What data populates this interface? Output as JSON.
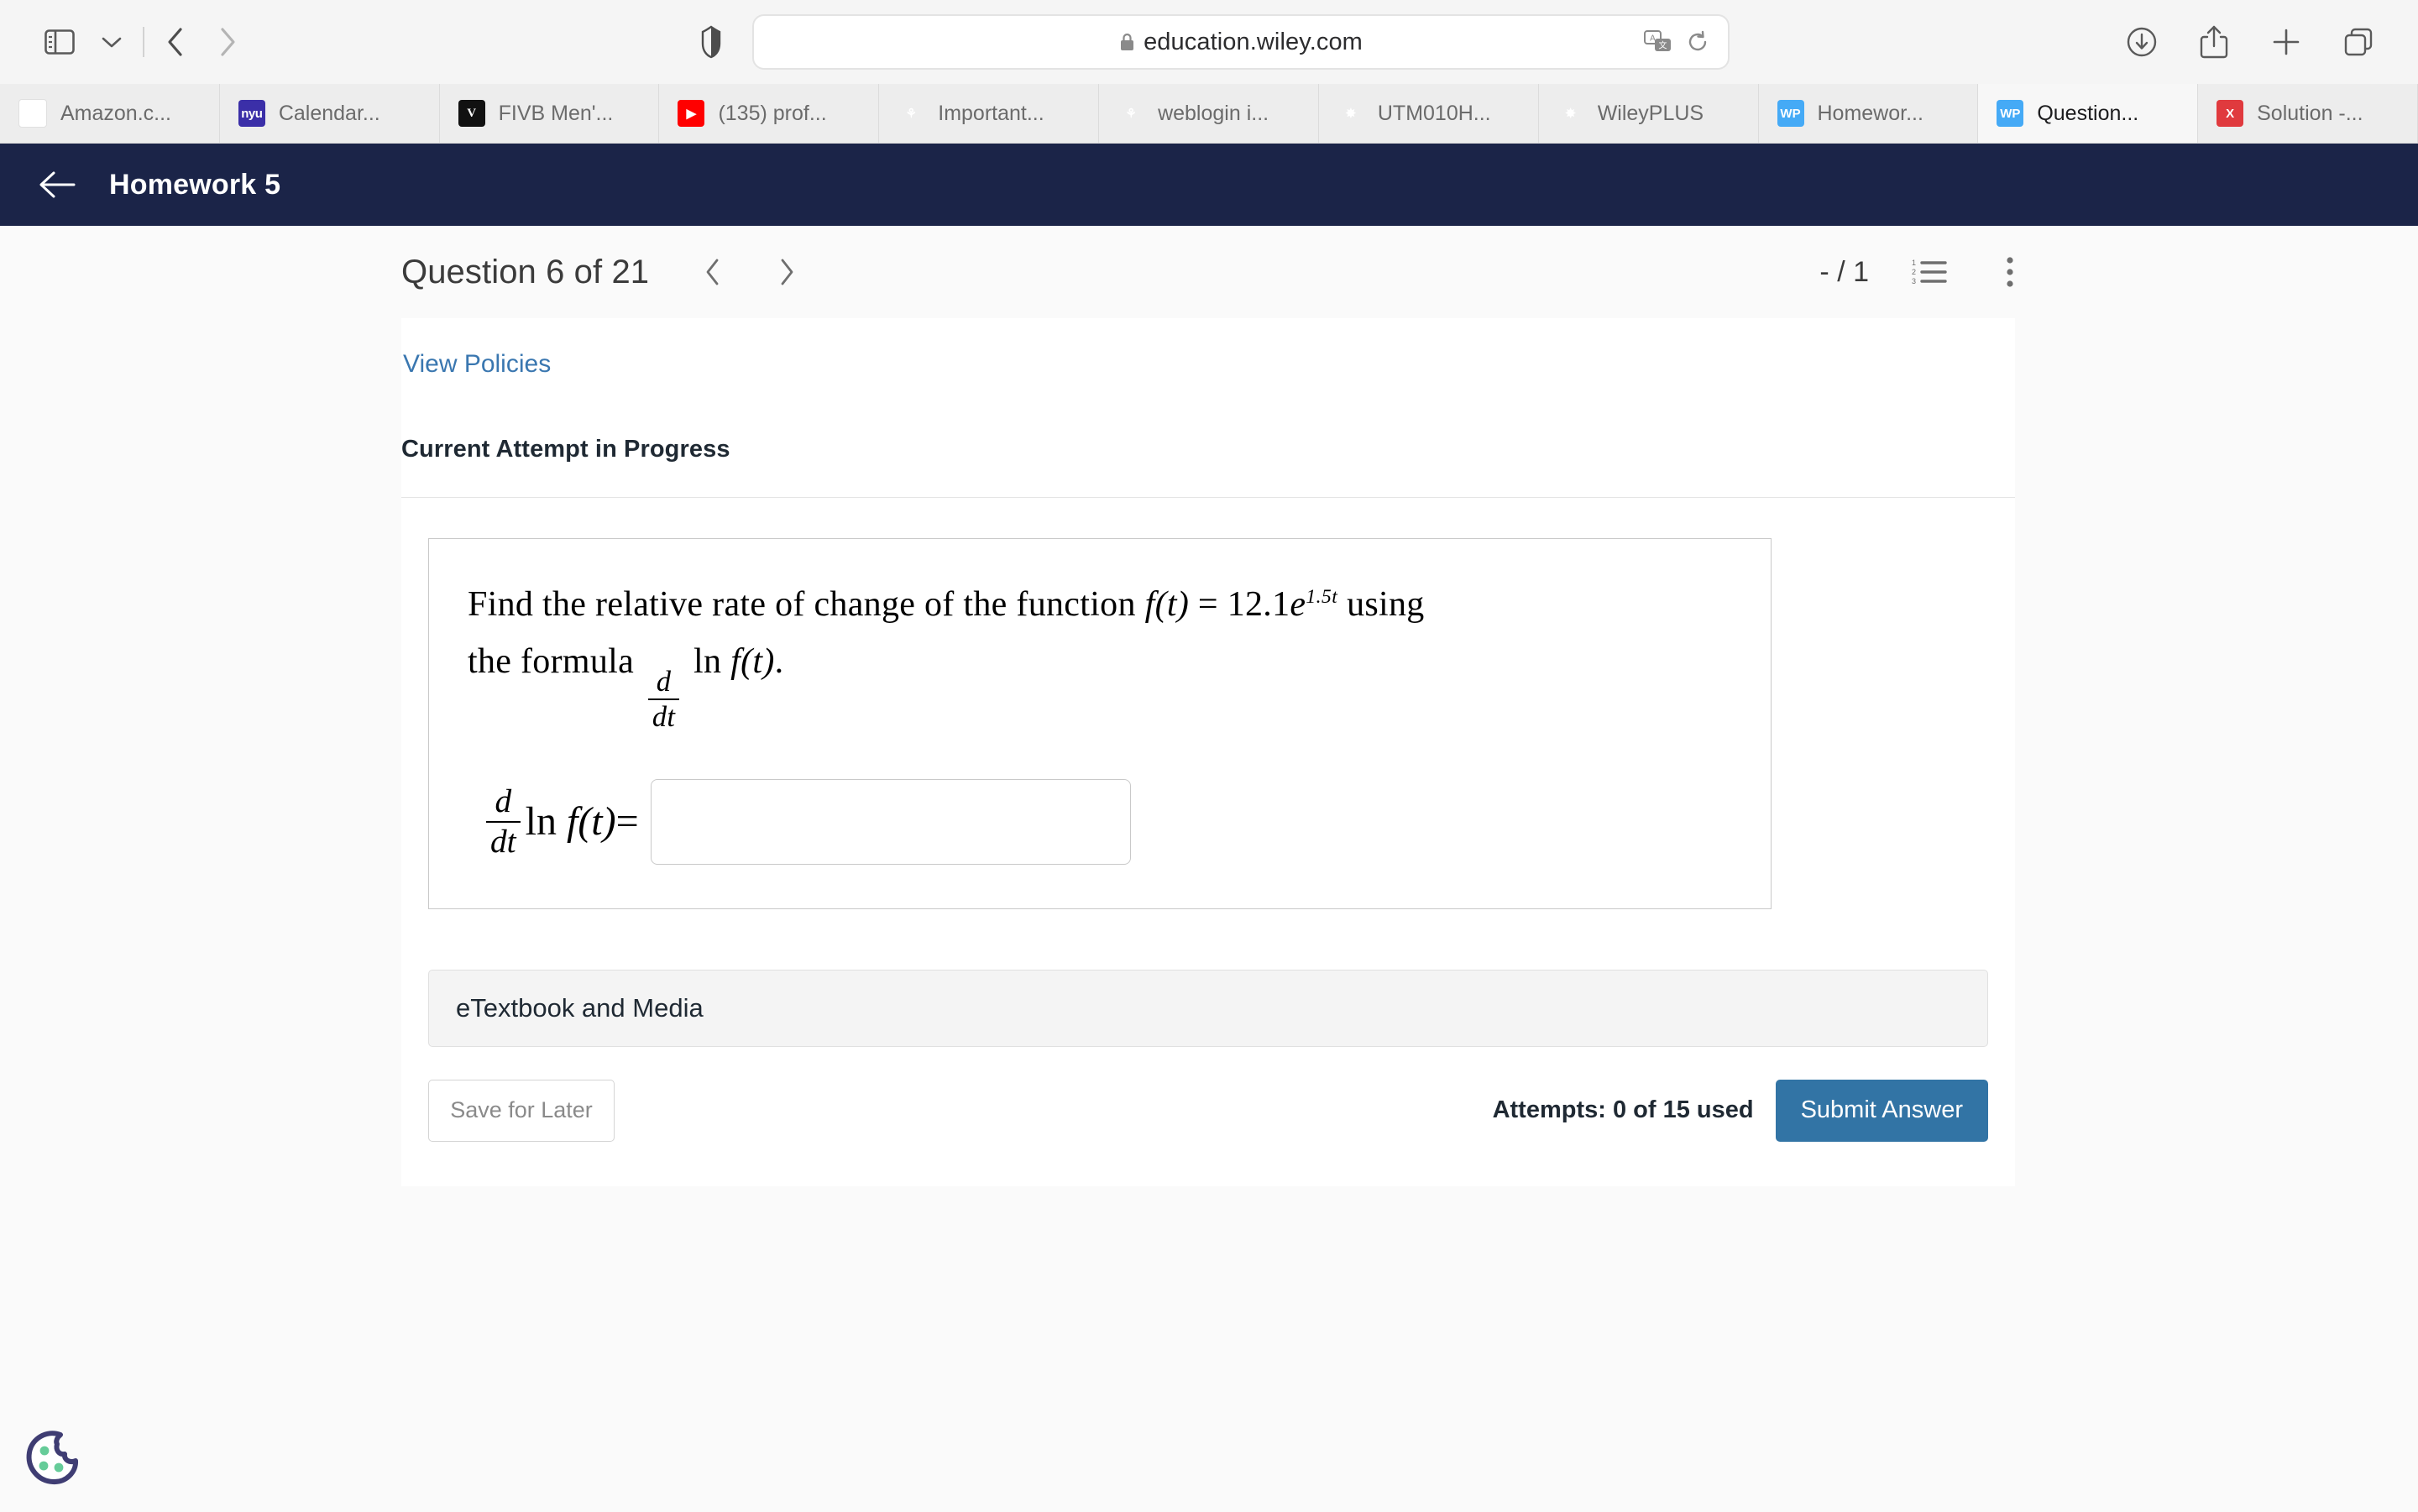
{
  "browser": {
    "toolbar": {
      "sidebar_icon": "sidebar-toggle-icon",
      "dropdown_icon": "chevron-down-icon",
      "back_icon": "back-chevron-icon",
      "forward_icon": "forward-chevron-icon",
      "shield_icon": "privacy-shield-icon",
      "url": "education.wiley.com",
      "lock_icon": "lock-icon",
      "translate_icon": "translate-icon",
      "reload_icon": "reload-icon",
      "download_icon": "download-icon",
      "share_icon": "share-icon",
      "newtab_icon": "plus-icon",
      "tabs_overview_icon": "tab-overview-icon"
    },
    "tabs": [
      {
        "title": "Amazon.c...",
        "favicon": "amazon-favicon",
        "glyph": "a",
        "style": "fv-amazon",
        "active": false
      },
      {
        "title": "Calendar...",
        "favicon": "nyu-favicon",
        "glyph": "nyu",
        "style": "fv-nyu",
        "active": false
      },
      {
        "title": "FIVB Men'...",
        "favicon": "fivb-favicon",
        "glyph": "V",
        "style": "fv-fivb",
        "active": false
      },
      {
        "title": "(135) prof...",
        "favicon": "youtube-favicon",
        "glyph": "▶",
        "style": "fv-yt",
        "active": false
      },
      {
        "title": "Important...",
        "favicon": "nyu-tree-favicon",
        "glyph": "⚘",
        "style": "fv-tree",
        "active": false
      },
      {
        "title": "weblogin i...",
        "favicon": "nyu-tree-favicon",
        "glyph": "⚘",
        "style": "fv-tree",
        "active": false
      },
      {
        "title": "UTM010H...",
        "favicon": "canvas-favicon",
        "glyph": "✸",
        "style": "fv-canvas",
        "active": false
      },
      {
        "title": "WileyPLUS",
        "favicon": "canvas-favicon",
        "glyph": "✸",
        "style": "fv-canvas",
        "active": false
      },
      {
        "title": "Homewor...",
        "favicon": "wileyplus-favicon",
        "glyph": "WP",
        "style": "fv-wp",
        "active": false
      },
      {
        "title": "Question...",
        "favicon": "wileyplus-favicon",
        "glyph": "WP",
        "style": "fv-wp",
        "active": true
      },
      {
        "title": "Solution -...",
        "favicon": "chegg-favicon",
        "glyph": "X",
        "style": "fv-x",
        "active": false
      }
    ]
  },
  "app_header": {
    "back_label": "back-arrow",
    "title": "Homework 5"
  },
  "question_header": {
    "title": "Question 6 of 21",
    "prev_icon": "chevron-left-icon",
    "next_icon": "chevron-right-icon",
    "score": "- / 1",
    "list_icon": "numbered-list-icon",
    "more_icon": "more-vertical-icon"
  },
  "content": {
    "view_policies": "View Policies",
    "attempt_status": "Current Attempt in Progress",
    "question": {
      "line1_a": "Find the relative rate of change of the function ",
      "fn_name": "f",
      "fn_arg": "(t)",
      "equals": " = ",
      "coefficient": "12.1",
      "base": "e",
      "exponent": "1.5t",
      "line1_b": " using",
      "line2_a": "the formula ",
      "frac_num": "d",
      "frac_den": "dt",
      "ln": " ln ",
      "line2_b": ".",
      "plain_text": "Find the relative rate of change of the function f(t) = 12.1e^{1.5t} using the formula d/dt ln f(t)."
    },
    "answer": {
      "lhs_frac_num": "d",
      "lhs_frac_den": "dt",
      "lhs_ln": "ln",
      "lhs_fn": "f",
      "lhs_arg": "(t)",
      "lhs_equals": "=",
      "value": "",
      "placeholder": ""
    },
    "etextbook_label": "eTextbook and Media",
    "save_label": "Save for Later",
    "attempts_label": "Attempts: 0 of 15 used",
    "submit_label": "Submit Answer"
  },
  "cookie_widget": {
    "icon": "cookie-consent-icon"
  },
  "colors": {
    "header_navy": "#1b2448",
    "link_blue": "#3a77b0",
    "submit_blue": "#3274a5",
    "page_bg": "#fafafa",
    "cookie_outline": "#3f3d73",
    "cookie_dot": "#66cc99"
  }
}
